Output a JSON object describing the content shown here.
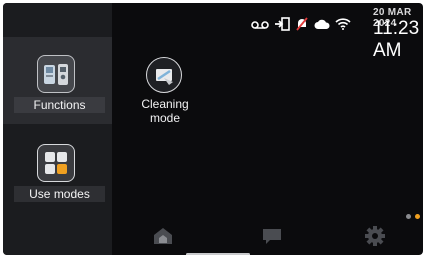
{
  "status_bar": {
    "date": "20 MAR 2024",
    "time": "11:23 AM",
    "icons": [
      "voicemail-icon",
      "door-exit-icon",
      "bell-muted-icon",
      "cloud-icon",
      "wifi-icon"
    ]
  },
  "sidebar": {
    "items": [
      {
        "label": "Functions",
        "icon": "intercom-devices-icon",
        "active": true
      },
      {
        "label": "Use modes",
        "icon": "grid-modes-icon",
        "active": false
      }
    ]
  },
  "main": {
    "tiles": [
      {
        "label": "Cleaning\nmode",
        "icon": "cleaning-wipe-icon"
      }
    ],
    "page_indicator": {
      "pages": 2,
      "current": 2
    }
  },
  "bottom_nav": [
    {
      "icon": "home-icon"
    },
    {
      "icon": "message-icon"
    },
    {
      "icon": "settings-gear-icon"
    }
  ],
  "colors": {
    "background": "#0b0b0d",
    "sidebar": "#1b1c1f",
    "accent": "#f0a020"
  }
}
